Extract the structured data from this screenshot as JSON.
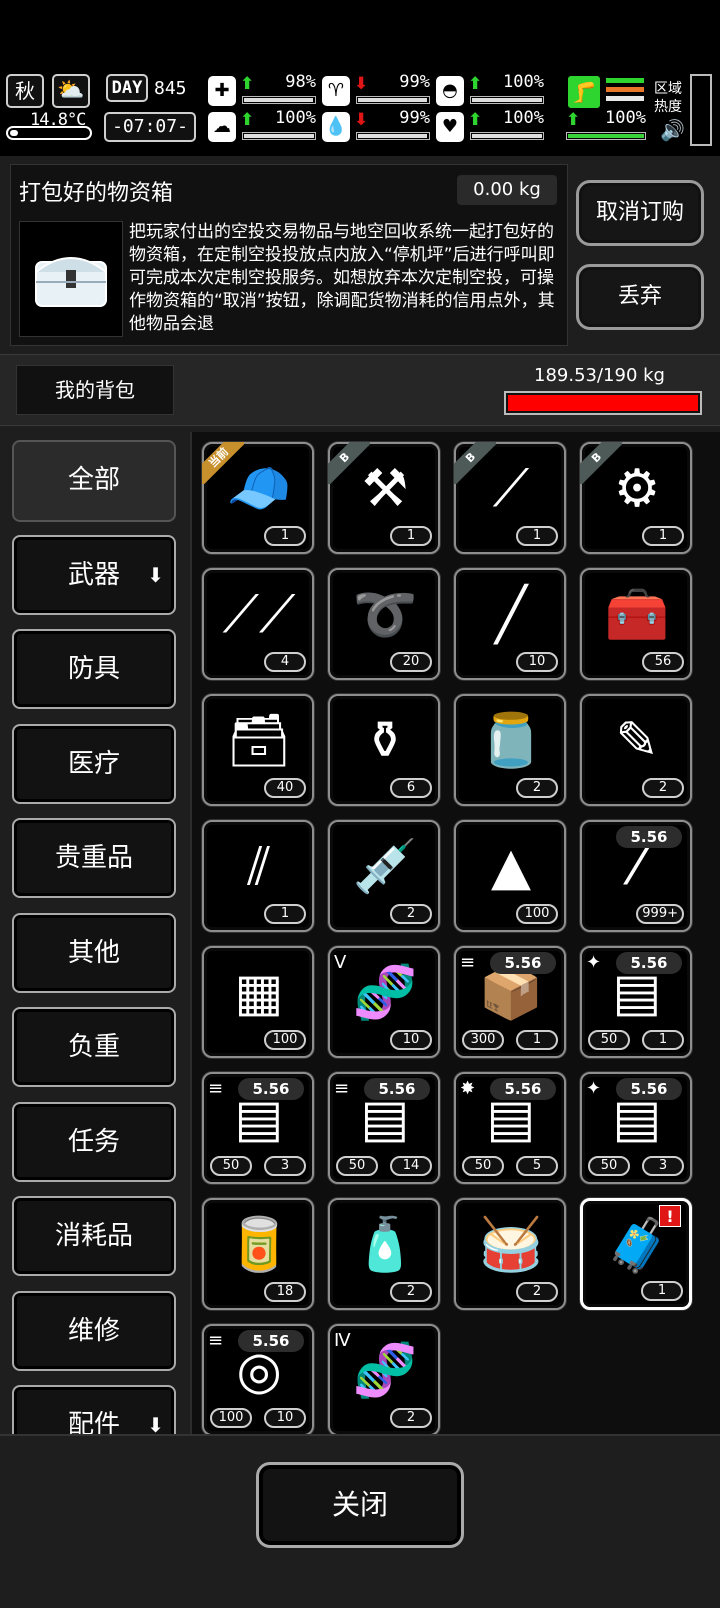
{
  "hud": {
    "season": "秋",
    "weather_icon": "partly-cloudy-icon",
    "temperature": "14.8°C",
    "day_label": "DAY",
    "day_number": "845",
    "time": "-07:07-",
    "stats_top": [
      {
        "icon": "medkit-icon",
        "glyph": "✚",
        "direction": "up",
        "value": "98%",
        "level": 0.98
      },
      {
        "icon": "stomach-icon",
        "glyph": "♈",
        "direction": "down",
        "value": "99%",
        "level": 0.99
      },
      {
        "icon": "pill-icon",
        "glyph": "◓",
        "direction": "up",
        "value": "100%",
        "level": 1.0
      }
    ],
    "stats_bottom": [
      {
        "icon": "brain-icon",
        "glyph": "☁",
        "direction": "up",
        "value": "100%",
        "level": 1.0
      },
      {
        "icon": "water-drop-icon",
        "glyph": "💧",
        "direction": "down",
        "value": "99%",
        "level": 0.99
      },
      {
        "icon": "heart-icon",
        "glyph": "♥",
        "direction": "up",
        "value": "100%",
        "level": 1.0
      }
    ],
    "stamina": {
      "icon": "leg-icon",
      "direction": "up",
      "value": "100%",
      "level": 1.0
    },
    "zone_heat_label": "区域热度",
    "sound_icon": "speaker-icon",
    "colors": {
      "up": "#2fd52f",
      "down": "#e01515",
      "stamina_bars": [
        "#2fd52f",
        "#e8772a",
        "#e8e8e8"
      ]
    }
  },
  "info": {
    "title": "打包好的物资箱",
    "weight": "0.00 kg",
    "image_icon": "supply-chest-icon",
    "description": "把玩家付出的空投交易物品与地空回收系统一起打包好的物资箱，在定制空投投放点内放入“停机坪”后进行呼叫即可完成本次定制空投服务。如想放弃本次定制空投，可操作物资箱的“取消”按钮，除调配货物消耗的信用点外，其他物品会退",
    "cancel_order_label": "取消订购",
    "discard_label": "丢弃"
  },
  "bag": {
    "label": "我的背包",
    "weight_text": "189.53/190 kg",
    "fill": 0.9975,
    "bar_color": "#ff0000"
  },
  "categories": [
    {
      "label": "全部",
      "active": true,
      "arrow": false
    },
    {
      "label": "武器",
      "active": false,
      "arrow": true
    },
    {
      "label": "防具",
      "active": false,
      "arrow": false
    },
    {
      "label": "医疗",
      "active": false,
      "arrow": false
    },
    {
      "label": "贵重品",
      "active": false,
      "arrow": false
    },
    {
      "label": "其他",
      "active": false,
      "arrow": false
    },
    {
      "label": "负重",
      "active": false,
      "arrow": false
    },
    {
      "label": "任务",
      "active": false,
      "arrow": false
    },
    {
      "label": "消耗品",
      "active": false,
      "arrow": false
    },
    {
      "label": "维修",
      "active": false,
      "arrow": false
    },
    {
      "label": "配件",
      "active": false,
      "arrow": true
    }
  ],
  "items": [
    {
      "name": "cap-icon",
      "glyph": "🧢",
      "count": "1",
      "tag": "当前",
      "tag_style": "gold"
    },
    {
      "name": "hammer-wrench-icon",
      "glyph": "⚒",
      "count": "1",
      "tag": "B",
      "tag_style": "grey"
    },
    {
      "name": "shovel-icon",
      "glyph": "⟋",
      "count": "1",
      "tag": "B",
      "tag_style": "grey"
    },
    {
      "name": "chainsaw-icon",
      "glyph": "⚙",
      "count": "1",
      "tag": "B",
      "tag_style": "grey"
    },
    {
      "name": "tweezers-icon",
      "glyph": "⟋⟋",
      "count": "4"
    },
    {
      "name": "rope-icon",
      "glyph": "➰",
      "count": "20"
    },
    {
      "name": "stick-icon",
      "glyph": "╱",
      "count": "10"
    },
    {
      "name": "toolkit-icon",
      "glyph": "🧰",
      "count": "56"
    },
    {
      "name": "toolbox-icon",
      "glyph": "🗃",
      "count": "40"
    },
    {
      "name": "bottles-icon",
      "glyph": "⚱",
      "count": "6"
    },
    {
      "name": "jar-snake-icon",
      "glyph": "🫙",
      "count": "2"
    },
    {
      "name": "syringe-small-icon",
      "glyph": "✎",
      "count": "2"
    },
    {
      "name": "ampoules-icon",
      "glyph": "⫽",
      "count": "1"
    },
    {
      "name": "syringe-icon",
      "glyph": "💉",
      "count": "2"
    },
    {
      "name": "cloth-icon",
      "glyph": "▲",
      "count": "100"
    },
    {
      "name": "bullet-icon",
      "glyph": "⁄",
      "count": "999+",
      "caliber": "5.56"
    },
    {
      "name": "towel-rack-icon",
      "glyph": "▦",
      "count": "100"
    },
    {
      "name": "dna-vial-v-icon",
      "glyph": "🧬",
      "count": "10",
      "badge_left": "Ⅴ"
    },
    {
      "name": "ammo-box-open-icon",
      "glyph": "📦",
      "count": "1",
      "count2": "300",
      "caliber": "5.56",
      "badge_left": "≡"
    },
    {
      "name": "ammo-box-purple-icon",
      "glyph": "▤",
      "count": "1",
      "count2": "50",
      "caliber": "5.56",
      "badge_left": "✦"
    },
    {
      "name": "ammo-box-grey-icon",
      "glyph": "▤",
      "count": "3",
      "count2": "50",
      "caliber": "5.56",
      "badge_left": "≡"
    },
    {
      "name": "ammo-box-grey2-icon",
      "glyph": "▤",
      "count": "14",
      "count2": "50",
      "caliber": "5.56",
      "badge_left": "≡"
    },
    {
      "name": "ammo-box-explosive-icon",
      "glyph": "▤",
      "count": "5",
      "count2": "50",
      "caliber": "5.56",
      "badge_left": "✸"
    },
    {
      "name": "ammo-box-purple2-icon",
      "glyph": "▤",
      "count": "3",
      "count2": "50",
      "caliber": "5.56",
      "badge_left": "✦"
    },
    {
      "name": "nut-can-icon",
      "glyph": "🥫",
      "count": "18"
    },
    {
      "name": "tube-icon",
      "glyph": "🧴",
      "count": "2"
    },
    {
      "name": "drum-icon",
      "glyph": "🥁",
      "count": "2"
    },
    {
      "name": "supply-chest-icon",
      "glyph": "🧳",
      "count": "1",
      "selected": true,
      "alert": "!"
    },
    {
      "name": "ammo-drum-icon",
      "glyph": "◎",
      "count": "10",
      "count2": "100",
      "caliber": "5.56",
      "badge_left": "≡"
    },
    {
      "name": "dna-vial-iv-icon",
      "glyph": "🧬",
      "count": "2",
      "badge_left": "Ⅳ"
    }
  ],
  "footer": {
    "close_label": "关闭"
  }
}
